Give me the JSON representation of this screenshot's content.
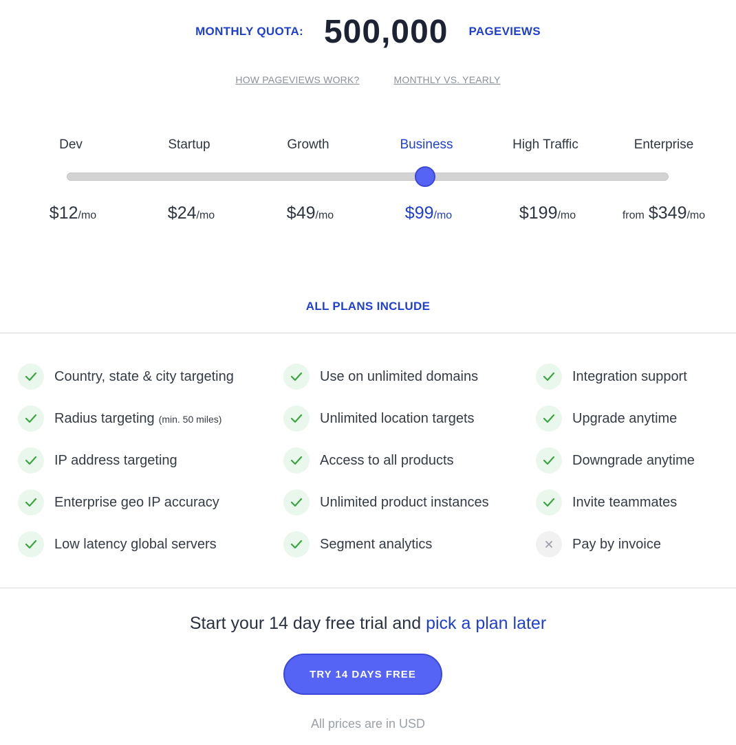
{
  "quota": {
    "label": "MONTHLY QUOTA:",
    "value": "500,000",
    "unit": "PAGEVIEWS"
  },
  "help_links": [
    "HOW PAGEVIEWS WORK?",
    "MONTHLY VS. YEARLY"
  ],
  "plans": [
    {
      "name": "Dev",
      "prefix": "",
      "price": "$12",
      "per": "/mo"
    },
    {
      "name": "Startup",
      "prefix": "",
      "price": "$24",
      "per": "/mo"
    },
    {
      "name": "Growth",
      "prefix": "",
      "price": "$49",
      "per": "/mo"
    },
    {
      "name": "Business",
      "prefix": "",
      "price": "$99",
      "per": "/mo"
    },
    {
      "name": "High Traffic",
      "prefix": "",
      "price": "$199",
      "per": "/mo"
    },
    {
      "name": "Enterprise",
      "prefix": "from",
      "price": "$349",
      "per": "/mo"
    }
  ],
  "selected_plan_index": 3,
  "all_plans_title": "ALL PLANS INCLUDE",
  "features": [
    [
      {
        "text": "Country, state & city targeting",
        "note": "",
        "included": true
      },
      {
        "text": "Radius targeting",
        "note": "(min. 50 miles)",
        "included": true
      },
      {
        "text": "IP address targeting",
        "note": "",
        "included": true
      },
      {
        "text": "Enterprise geo IP accuracy",
        "note": "",
        "included": true
      },
      {
        "text": "Low latency global servers",
        "note": "",
        "included": true
      }
    ],
    [
      {
        "text": "Use on unlimited domains",
        "note": "",
        "included": true
      },
      {
        "text": "Unlimited location targets",
        "note": "",
        "included": true
      },
      {
        "text": "Access to all products",
        "note": "",
        "included": true
      },
      {
        "text": "Unlimited product instances",
        "note": "",
        "included": true
      },
      {
        "text": "Segment analytics",
        "note": "",
        "included": true
      }
    ],
    [
      {
        "text": "Integration support",
        "note": "",
        "included": true
      },
      {
        "text": "Upgrade anytime",
        "note": "",
        "included": true
      },
      {
        "text": "Downgrade anytime",
        "note": "",
        "included": true
      },
      {
        "text": "Invite teammates",
        "note": "",
        "included": true
      },
      {
        "text": "Pay by invoice",
        "note": "",
        "included": false
      }
    ]
  ],
  "trial": {
    "text": "Start your 14 day free trial and",
    "link": "pick a plan later"
  },
  "cta_label": "TRY 14 DAYS FREE",
  "currency_note": "All prices are in USD",
  "colors": {
    "accent": "#1f3fd1",
    "button": "#5564f5",
    "check": "#3aa53f",
    "check_bg": "#eaf7ec"
  },
  "icons": {
    "included": "check-icon",
    "excluded": "x-icon"
  }
}
